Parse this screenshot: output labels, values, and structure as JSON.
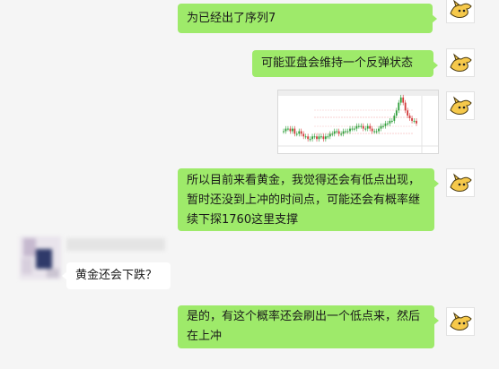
{
  "messages": [
    {
      "sender": "me",
      "text": "为已经出了序列7"
    },
    {
      "sender": "me",
      "text": "可能亚盘会维持一个反弹状态"
    },
    {
      "sender": "me",
      "type": "image",
      "description": "gold-price-chart"
    },
    {
      "sender": "me",
      "text": "所以目前来看黄金，我觉得还会有低点出现，暂时还没到上冲的时间点，可能还会有概率继续下探1760这里支撑"
    },
    {
      "sender": "them",
      "text": "黄金还会下跌？"
    },
    {
      "sender": "me",
      "text": "是的，有这个概率还会刷出一个低点来，然后在上冲"
    }
  ],
  "colors": {
    "background": "#f5f5f5",
    "my_bubble": "#9eea6a",
    "their_bubble": "#ffffff",
    "avatar_fill": "#f6c94b"
  },
  "chart_series": {
    "candles_open": [
      5,
      5,
      6,
      6,
      5,
      6,
      4,
      4,
      5,
      4,
      3,
      3,
      2,
      2,
      3,
      3,
      2,
      3,
      3,
      2,
      3,
      3,
      4,
      4,
      5,
      5,
      4,
      4,
      5,
      5,
      5,
      6,
      6,
      6,
      7,
      7,
      7,
      6,
      6,
      7,
      6,
      5,
      5,
      5,
      6,
      7,
      7,
      8,
      8,
      9,
      9,
      11,
      13,
      16,
      18,
      16,
      13,
      11,
      10,
      9,
      9
    ],
    "candles_close": [
      5,
      6,
      6,
      5,
      6,
      4,
      4,
      5,
      4,
      3,
      3,
      2,
      2,
      3,
      3,
      2,
      3,
      3,
      2,
      3,
      3,
      4,
      4,
      5,
      5,
      4,
      4,
      5,
      5,
      5,
      6,
      6,
      6,
      7,
      7,
      7,
      6,
      6,
      7,
      6,
      5,
      5,
      5,
      6,
      7,
      7,
      8,
      8,
      9,
      9,
      11,
      13,
      16,
      18,
      16,
      13,
      11,
      10,
      9,
      9,
      8
    ]
  }
}
